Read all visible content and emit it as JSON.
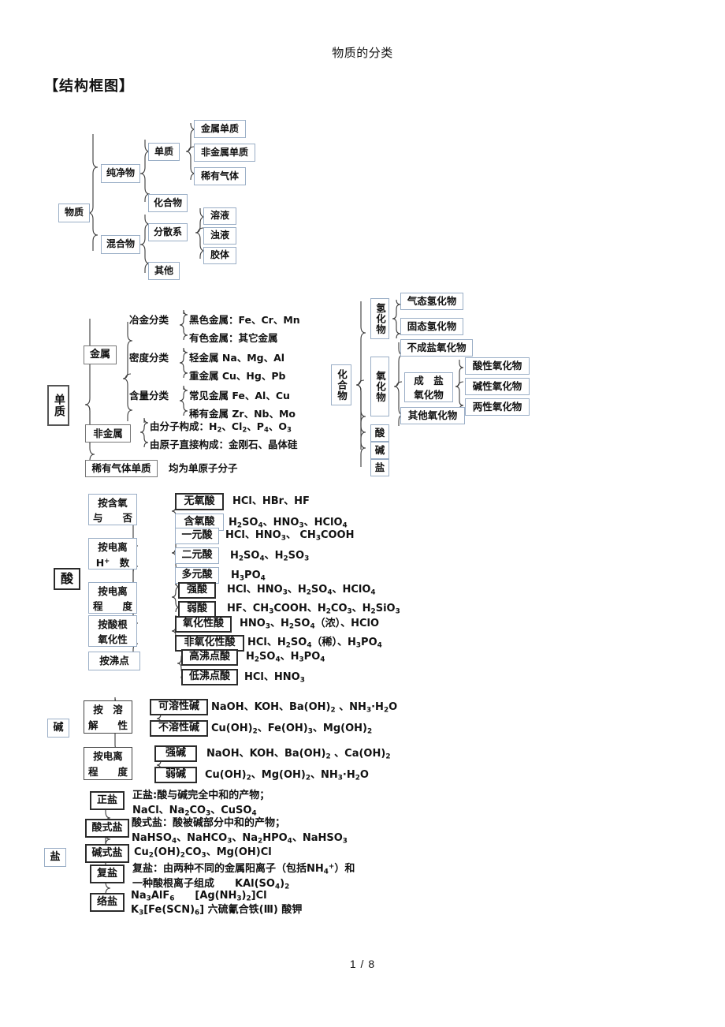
{
  "document": {
    "title": "物质的分类",
    "section_heading": "【结构框图】",
    "footer": "1 / 8"
  },
  "diagram1": {
    "root": "物质",
    "pure": "纯净物",
    "element": "单质",
    "element_children": [
      "金属单质",
      "非金属单质",
      "稀有气体"
    ],
    "compound": "化合物",
    "mixture": "混合物",
    "disperse": "分散系",
    "disperse_children": [
      "溶液",
      "浊液",
      "胶体"
    ],
    "other": "其他"
  },
  "diagram2": {
    "root": "单质",
    "metal": "金属",
    "metal_groups": [
      {
        "label": "冶金分类",
        "rows": [
          "黑色金属：Fe、Cr、Mn",
          "有色金属：其它金属"
        ]
      },
      {
        "label": "密度分类",
        "rows": [
          "轻金属 Na、Mg、Al",
          "重金属 Cu、Hg、Pb"
        ]
      },
      {
        "label": "含量分类",
        "rows": [
          "常见金属 Fe、Al、Cu",
          "稀有金属 Zr、Nb、Mo"
        ]
      }
    ],
    "nonmetal": "非金属",
    "nonmetal_rows": [
      "由分子构成：H2、Cl2、P4、O3",
      "由原子直接构成：金刚石、晶体硅"
    ],
    "noble": "稀有气体单质",
    "noble_note": "均为单原子分子"
  },
  "diagram3": {
    "root": "化合物",
    "hydride": "氢化物",
    "hydride_children": [
      "气态氢化物",
      "固态氢化物"
    ],
    "oxide": "氧化物",
    "oxide_non_salt": "不成盐氧化物",
    "oxide_salt": "成 盐\n氧化物",
    "oxide_salt_children": [
      "酸性氧化物",
      "碱性氧化物",
      "两性氧化物"
    ],
    "oxide_other": "其他氧化物",
    "acid": "酸",
    "base": "碱",
    "salt": "盐"
  },
  "acid_section": {
    "root": "酸",
    "groups": [
      {
        "label": "按含氧\n与　　否",
        "items": [
          {
            "name": "无氧酸",
            "examples": "HCl、HBr、HF"
          },
          {
            "name": "含氧酸",
            "examples": "H2SO4、HNO3、HClO4"
          }
        ]
      },
      {
        "label": "按电离\nH+　数",
        "items": [
          {
            "name": "一元酸",
            "examples": "HCl、HNO3、CH3COOH"
          },
          {
            "name": "二元酸",
            "examples": "H2SO4、H2SO3"
          },
          {
            "name": "多元酸",
            "examples": "H3PO4"
          }
        ]
      },
      {
        "label": "按电离\n程　　度",
        "items": [
          {
            "name": "强酸",
            "examples": "HCl、HNO3、H2SO4、HClO4"
          },
          {
            "name": "弱酸",
            "examples": "HF、CH3COOH、H2CO3、H2SiO3"
          }
        ]
      },
      {
        "label": "按酸根\n氧化性",
        "items": [
          {
            "name": "氧化性酸",
            "examples": "HNO3、H2SO4（浓）、HClO"
          },
          {
            "name": "非氧化性酸",
            "examples": "HCl、H2SO4（稀）、H3PO4"
          }
        ]
      },
      {
        "label": "按沸点",
        "items": [
          {
            "name": "高沸点酸",
            "examples": "H2SO4、H3PO4"
          },
          {
            "name": "低沸点酸",
            "examples": "HCl、HNO3"
          }
        ]
      }
    ]
  },
  "base_section": {
    "root": "碱",
    "groups": [
      {
        "label": "按　溶\n解　　性",
        "items": [
          {
            "name": "可溶性碱",
            "examples": "NaOH、KOH、Ba(OH)2 、NH3·H2O"
          },
          {
            "name": "不溶性碱",
            "examples": "Cu(OH)2、Fe(OH)3、Mg(OH)2"
          }
        ]
      },
      {
        "label": "按电离\n程　　度",
        "items": [
          {
            "name": "强碱",
            "examples": "NaOH、KOH、Ba(OH)2 、Ca(OH)2"
          },
          {
            "name": "弱碱",
            "examples": "Cu(OH)2、Mg(OH)2、NH3·H2O"
          }
        ]
      }
    ]
  },
  "salt_section": {
    "root": "盐",
    "items": [
      {
        "name": "正盐",
        "line1": "正盐:酸与碱完全中和的产物；",
        "line2": "NaCl、Na2CO3、CuSO4"
      },
      {
        "name": "酸式盐",
        "line1": "酸式盐：酸被碱部分中和的产物；",
        "line2": "NaHSO4、NaHCO3、Na2HPO4、NaHSO3"
      },
      {
        "name": "碱式盐",
        "line1": "Cu2(OH)2CO3、Mg(OH)Cl",
        "line2": ""
      },
      {
        "name": "复盐",
        "line1": "复盐：由两种不同的金属阳离子（包括NH4+）和",
        "line2": "一种酸根离子组成　　KAl(SO4)2"
      },
      {
        "name": "络盐",
        "line1": "Na3AlF6　　[Ag(NH3)2]Cl",
        "line2": "K3[Fe(SCN)6] 六硫氰合铁(Ⅲ) 酸钾"
      }
    ]
  },
  "colors": {
    "box_border_light": "#9aaec6",
    "box_border_dark": "#2b2b2b",
    "brace_stroke": "#3a3a3a",
    "text": "#111111"
  }
}
